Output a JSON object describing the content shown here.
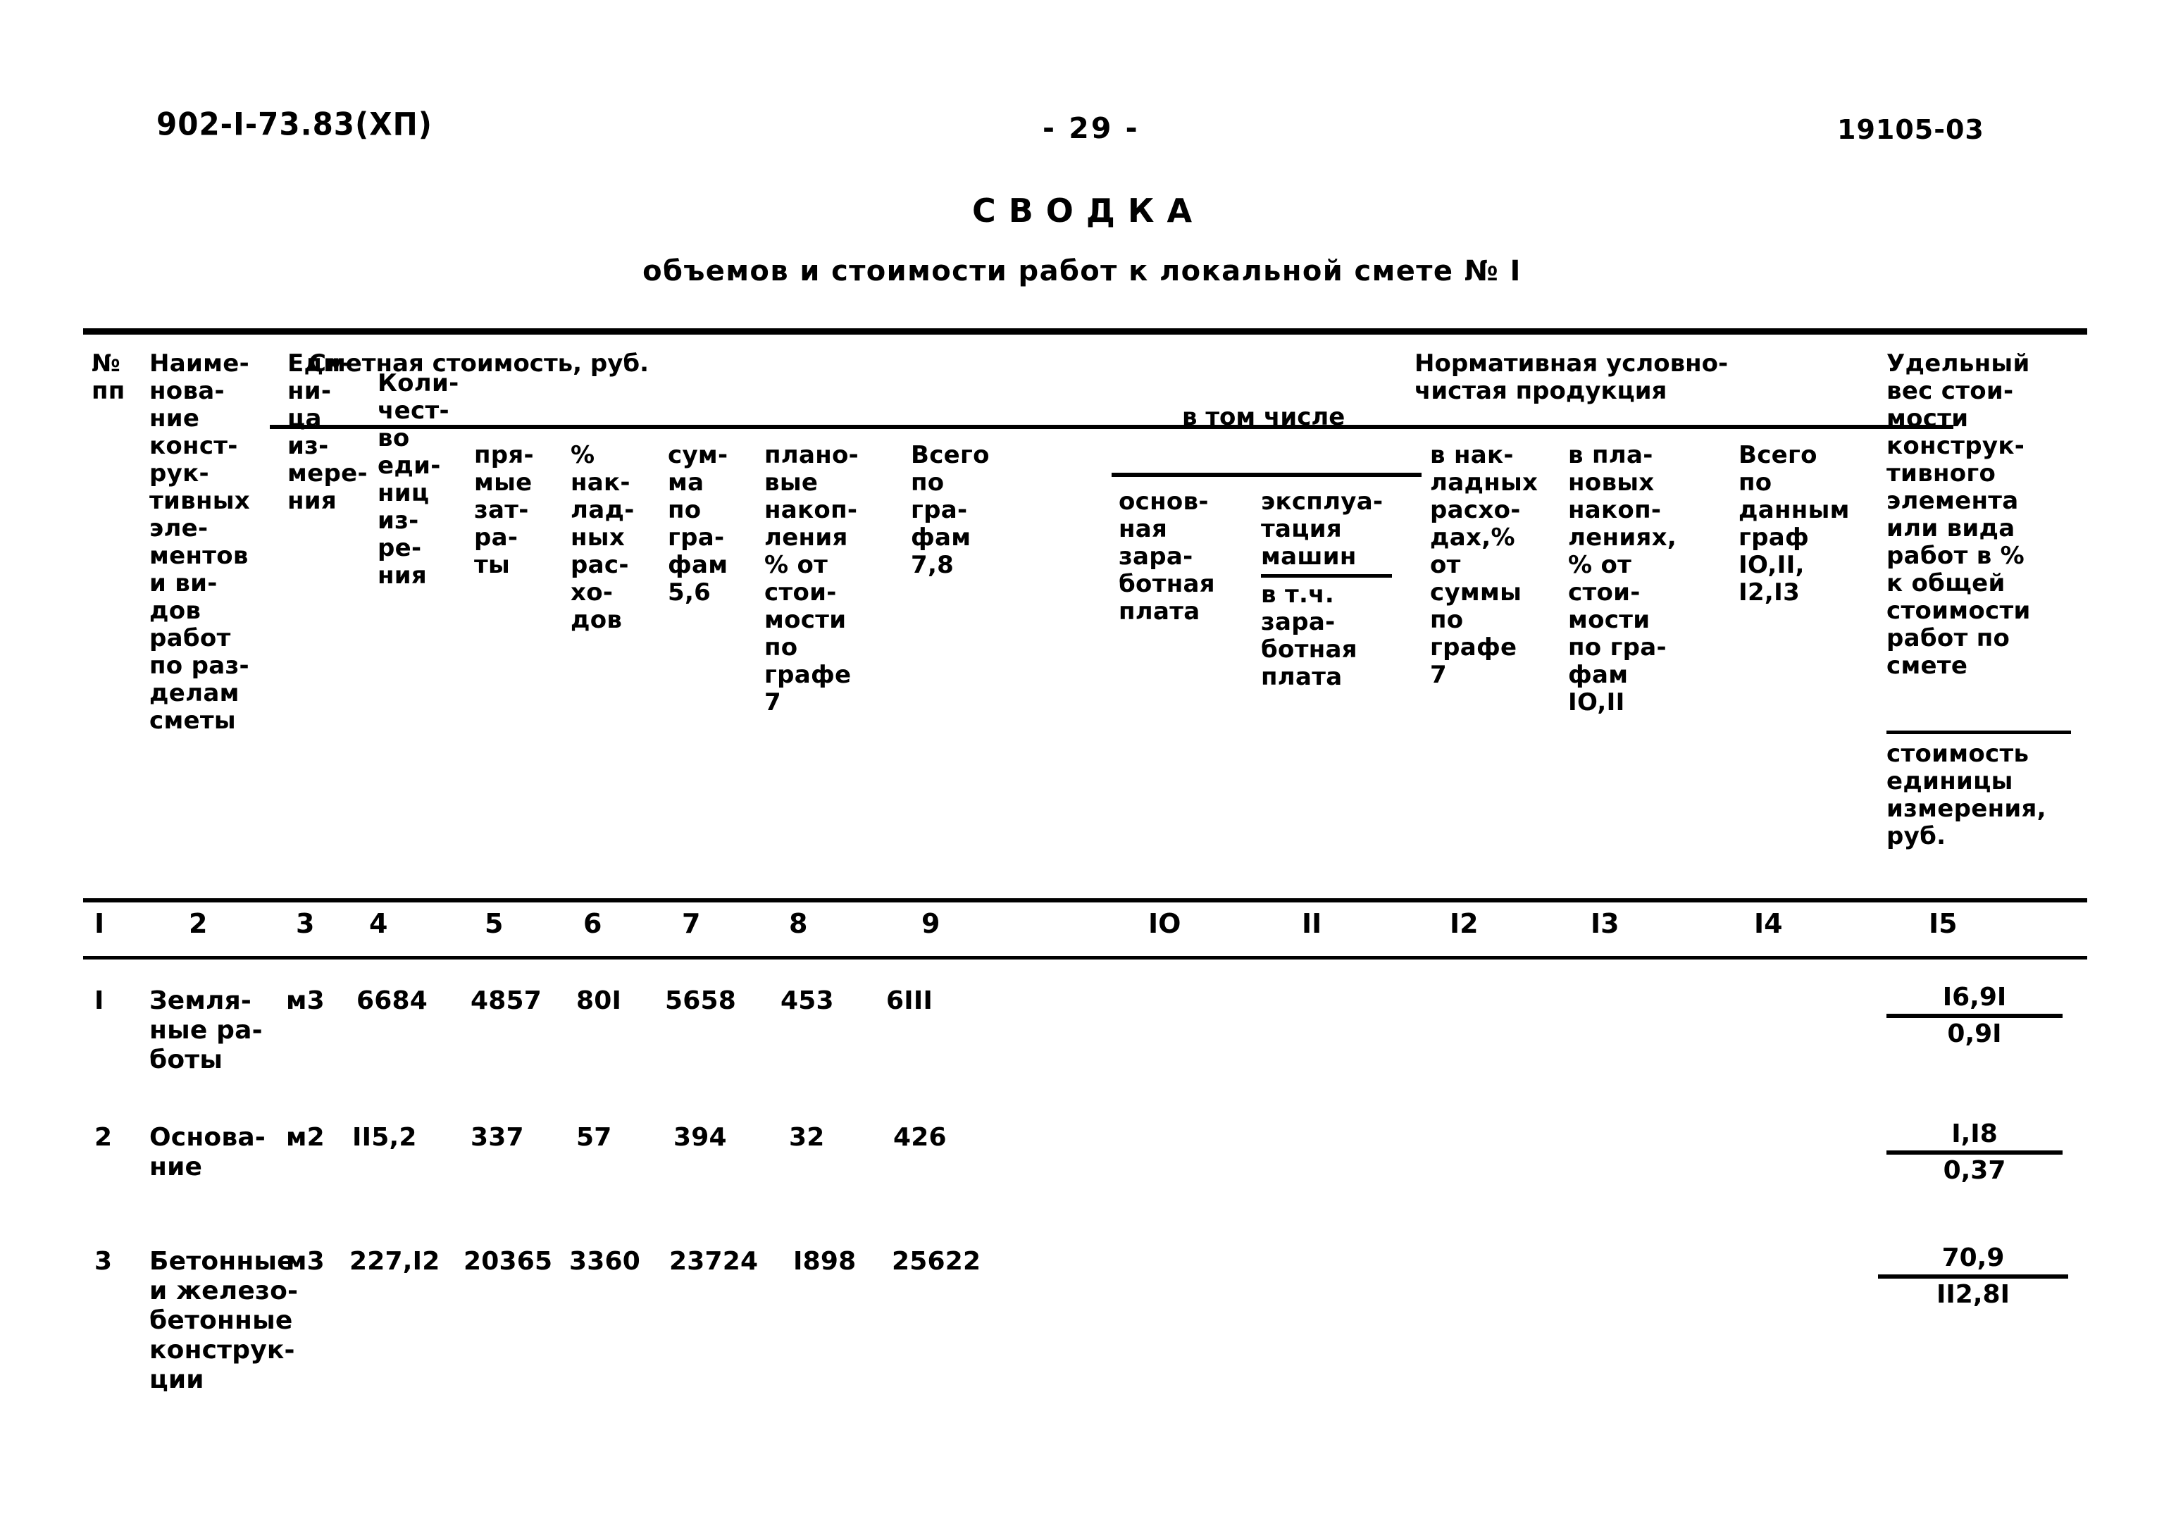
{
  "header": {
    "doc_code": "902-I-73.83(ХП)",
    "page_number": "- 29 -",
    "stamp_code": "19105-03"
  },
  "title": {
    "main": "СВОДКА",
    "subtitle": "объемов и стоимости работ к локальной смете № I"
  },
  "table": {
    "group_headers": {
      "smetnaya": "Сметная стоимость, руб.",
      "v_tom_chisle": "в том числе",
      "normativnaya": "Нормативная условно-\nчистая продукция"
    },
    "columns": [
      {
        "num": "I",
        "title": "№\nпп"
      },
      {
        "num": "2",
        "title": "Наиме-\nнова-\nние\nконст-\nрук-\nтивных\nэле-\nментов\nи ви-\nдов\nработ\nпо раз-\nделам\nсметы"
      },
      {
        "num": "3",
        "title": "Еди-\nни-\nца\nиз-\nмере-\nния"
      },
      {
        "num": "4",
        "title": "Коли-\nчест-\nво\nеди-\nниц\nиз-\nре-\nния"
      },
      {
        "num": "5",
        "title": "пря-\nмые\nзат-\nра-\nты"
      },
      {
        "num": "6",
        "title": "%\nнак-\nлад-\nных\nрас-\nхо-\nдов"
      },
      {
        "num": "7",
        "title": "сум-\nма\nпо\nгра-\nфам\n5,6"
      },
      {
        "num": "8",
        "title": "плано-\nвые\nнакоп-\nления\n% от\nстои-\nмости\nпо\nграфе\n7"
      },
      {
        "num": "9",
        "title": "Всего\nпо\nгра-\nфам\n7,8"
      },
      {
        "num": "IO",
        "title": "основ-\nная\nзара-\nботная\nплата"
      },
      {
        "num": "II",
        "title": "эксплуа-\nтация\nмашин",
        "title_underlined_tail": "в т.ч.\nзара-\nботная\nплата"
      },
      {
        "num": "I2",
        "title": "в нак-\nладных\nрасхо-\nдах,%\nот\nсуммы\nпо\nграфе\n7"
      },
      {
        "num": "I3",
        "title": "в пла-\nновых\nнакоп-\nлениях,\n% от\nстои-\nмости\nпо гра-\nфам\nIO,II"
      },
      {
        "num": "I4",
        "title": "Всего\nпо\nданным\nграф\nIO,II,\nI2,I3"
      },
      {
        "num": "I5",
        "title_top": "Удельный\nвес стои-\nмости\nконструк-\nтивного\nэлемента\nили вида\nработ в %\nк общей\nстоимости\nработ по\nсмете",
        "title_bottom": "стоимость\nединицы\nизмерения,\nруб."
      }
    ],
    "rows": [
      {
        "c1": "I",
        "c2": "Земля-\nные ра-\nботы",
        "c3": "м3",
        "c4": "6684",
        "c5": "4857",
        "c6": "80I",
        "c7": "5658",
        "c8": "453",
        "c9": "6III",
        "c10": "",
        "c11": "",
        "c12": "",
        "c13": "",
        "c14": "",
        "c15_top": "I6,9I",
        "c15_bottom": "0,9I"
      },
      {
        "c1": "2",
        "c2": "Основа-\nние",
        "c3": "м2",
        "c4": "II5,2",
        "c5": "337",
        "c6": "57",
        "c7": "394",
        "c8": "32",
        "c9": "426",
        "c10": "",
        "c11": "",
        "c12": "",
        "c13": "",
        "c14": "",
        "c15_top": "I,I8",
        "c15_bottom": "0,37"
      },
      {
        "c1": "3",
        "c2": "Бетонные\nи железо-\nбетонные\nконструк-\nции",
        "c3": "м3",
        "c4": "227,I2",
        "c5": "20365",
        "c6": "3360",
        "c7": "23724",
        "c8": "I898",
        "c9": "25622",
        "c10": "",
        "c11": "",
        "c12": "",
        "c13": "",
        "c14": "",
        "c15_top": "70,9",
        "c15_bottom": "II2,8I"
      }
    ]
  }
}
